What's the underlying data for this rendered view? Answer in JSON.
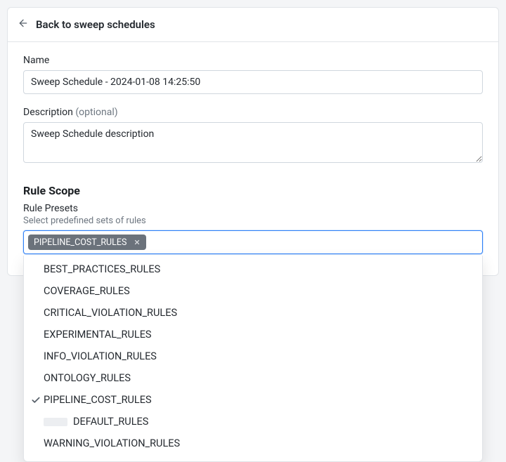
{
  "header": {
    "back_label": "Back to sweep schedules"
  },
  "form": {
    "name_label": "Name",
    "name_value": "Sweep Schedule - 2024-01-08 14:25:50",
    "desc_label": "Description ",
    "desc_optional": "(optional)",
    "desc_value": "Sweep Schedule description"
  },
  "rule_scope": {
    "heading": "Rule Scope",
    "presets_label": "Rule Presets",
    "presets_helper": "Select predefined sets of rules",
    "selected_chip": "PIPELINE_COST_RULES",
    "options": [
      {
        "label": "BEST_PRACTICES_RULES",
        "selected": false,
        "child": false
      },
      {
        "label": "COVERAGE_RULES",
        "selected": false,
        "child": false
      },
      {
        "label": "CRITICAL_VIOLATION_RULES",
        "selected": false,
        "child": false
      },
      {
        "label": "EXPERIMENTAL_RULES",
        "selected": false,
        "child": false
      },
      {
        "label": "INFO_VIOLATION_RULES",
        "selected": false,
        "child": false
      },
      {
        "label": "ONTOLOGY_RULES",
        "selected": false,
        "child": false
      },
      {
        "label": "PIPELINE_COST_RULES",
        "selected": true,
        "child": false
      },
      {
        "label": "DEFAULT_RULES",
        "selected": false,
        "child": true
      },
      {
        "label": "WARNING_VIOLATION_RULES",
        "selected": false,
        "child": false
      }
    ]
  }
}
